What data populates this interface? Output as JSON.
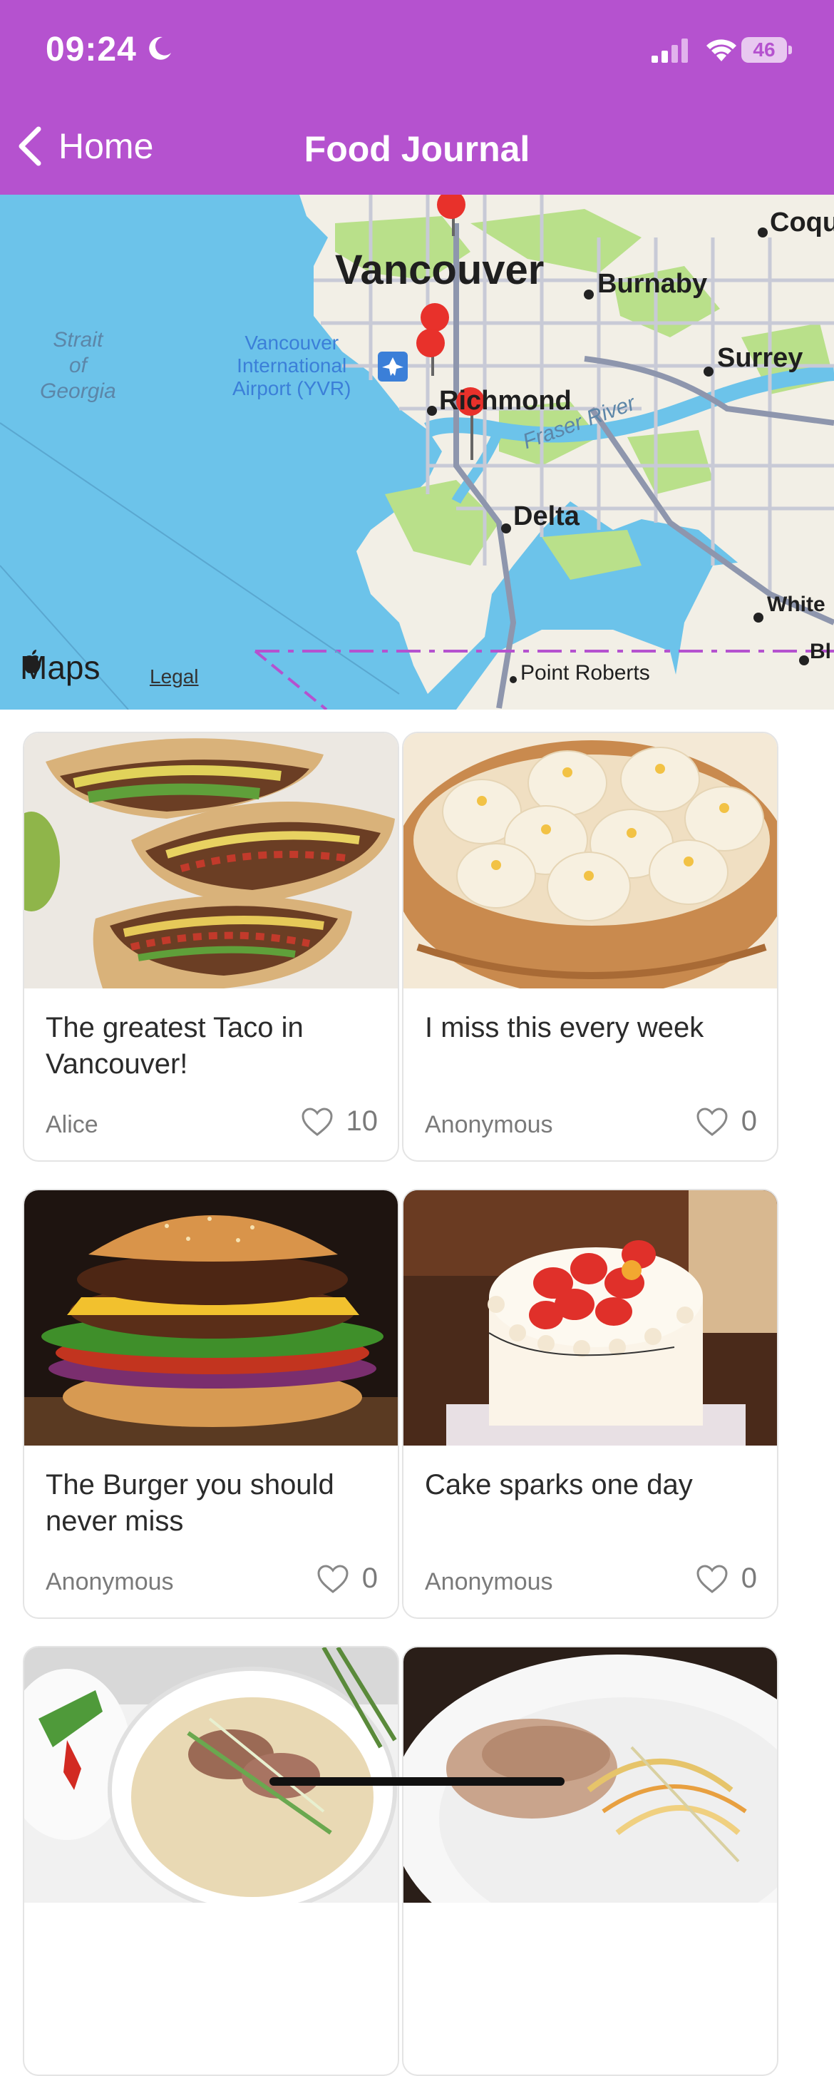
{
  "status_bar": {
    "time": "09:24",
    "battery": "46"
  },
  "nav": {
    "back_label": "Home",
    "title": "Food Journal"
  },
  "map": {
    "labels": {
      "vancouver": "Vancouver",
      "burnaby": "Burnaby",
      "surrey": "Surrey",
      "richmond": "Richmond",
      "delta": "Delta",
      "coquitlam": "Coqu",
      "white_rock": "White",
      "point_roberts": "Point Roberts",
      "bl": "Bl",
      "strait": "Strait\nof\nGeorgia",
      "fraser": "Fraser River",
      "airport": "Vancouver\nInternational\nAirport (YVR)"
    },
    "branding": "Maps",
    "legal": "Legal",
    "pin_color": "#e8312b",
    "pin_count": 5
  },
  "posts": [
    {
      "title": "The greatest Taco in Vancouver!",
      "author": "Alice",
      "likes": "10",
      "image": "tacos"
    },
    {
      "title": "I miss this every week",
      "author": "Anonymous",
      "likes": "0",
      "image": "dumplings"
    },
    {
      "title": "The Burger you should never miss",
      "author": "Anonymous",
      "likes": "0",
      "image": "burger"
    },
    {
      "title": "Cake sparks one day",
      "author": "Anonymous",
      "likes": "0",
      "image": "strawberry-cake"
    },
    {
      "image": "pho"
    },
    {
      "image": "noodles"
    }
  ],
  "colors": {
    "accent": "#b552cf",
    "land": "#f2efe6",
    "park": "#b9e08a",
    "water": "#6cc3ea"
  }
}
